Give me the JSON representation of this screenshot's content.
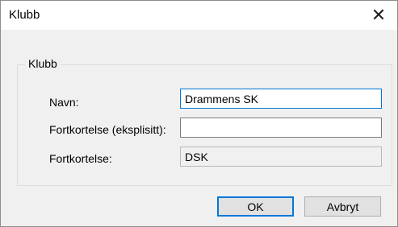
{
  "window": {
    "title": "Klubb",
    "close_glyph": "✕"
  },
  "group": {
    "legend": "Klubb"
  },
  "fields": {
    "navn": {
      "label": "Navn:",
      "value": "Drammens SK"
    },
    "fortkortelse_eksplisitt": {
      "label": "Fortkortelse (eksplisitt):",
      "value": ""
    },
    "fortkortelse": {
      "label": "Fortkortelse:",
      "value": "DSK"
    }
  },
  "buttons": {
    "ok": "OK",
    "cancel": "Avbryt"
  },
  "colors": {
    "accent": "#0078d7",
    "background": "#f0f0f0"
  }
}
